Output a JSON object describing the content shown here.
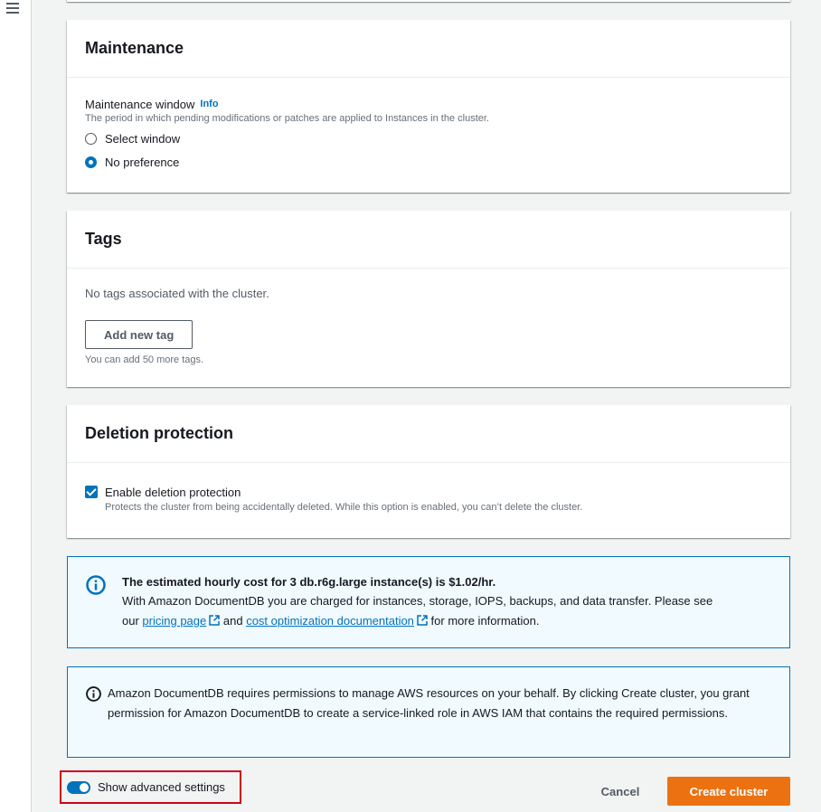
{
  "maintenance": {
    "title": "Maintenance",
    "window_label": "Maintenance window",
    "info": "Info",
    "description": "The period in which pending modifications or patches are applied to Instances in the cluster.",
    "options": [
      {
        "label": "Select window",
        "selected": false
      },
      {
        "label": "No preference",
        "selected": true
      }
    ]
  },
  "tags": {
    "title": "Tags",
    "empty_text": "No tags associated with the cluster.",
    "add_button": "Add new tag",
    "hint": "You can add 50 more tags."
  },
  "deletion": {
    "title": "Deletion protection",
    "checkbox_label": "Enable deletion protection",
    "checked": true,
    "description": "Protects the cluster from being accidentally deleted. While this option is enabled, you can’t delete the cluster."
  },
  "cost_alert": {
    "heading": "The estimated hourly cost for 3 db.r6g.large instance(s) is $1.02/hr.",
    "line1": "With Amazon DocumentDB you are charged for instances, storage, IOPS, backups, and data transfer. Please see",
    "our": "our",
    "pricing_link": "pricing page",
    "and": "and",
    "docs_link": "cost optimization documentation",
    "tail": "for more information."
  },
  "permission_alert": {
    "text": "Amazon DocumentDB requires permissions to manage AWS resources on your behalf. By clicking Create cluster, you grant permission for Amazon DocumentDB to create a service-linked role in AWS IAM that contains the required permissions."
  },
  "footer": {
    "advanced_label": "Show advanced settings",
    "advanced_on": true,
    "cancel": "Cancel",
    "create": "Create cluster"
  },
  "colors": {
    "accent": "#0073bb",
    "primary_button": "#ec7211",
    "highlight_box": "#d0021b"
  }
}
